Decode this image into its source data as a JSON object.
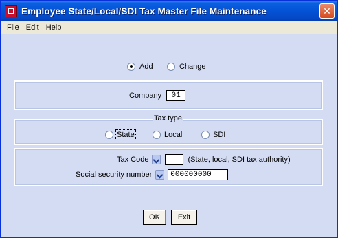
{
  "window": {
    "title": "Employee State/Local/SDI Tax Master File Maintenance",
    "close_label": "✕"
  },
  "menu": {
    "items": [
      {
        "label": "File"
      },
      {
        "label": "Edit"
      },
      {
        "label": "Help"
      }
    ]
  },
  "mode": {
    "add_label": "Add",
    "change_label": "Change",
    "selected": "Add"
  },
  "company": {
    "label": "Company",
    "value": "01"
  },
  "tax_type": {
    "title": "Tax type",
    "options": [
      {
        "label": "State",
        "selected": false
      },
      {
        "label": "Local",
        "selected": false
      },
      {
        "label": "SDI",
        "selected": false
      }
    ]
  },
  "tax_code": {
    "label": "Tax Code",
    "value": "",
    "hint": "(State, local, SDI tax authority)"
  },
  "ssn": {
    "label": "Social security number",
    "value": "000000000"
  },
  "buttons": {
    "ok_label": "OK",
    "exit_label": "Exit"
  }
}
